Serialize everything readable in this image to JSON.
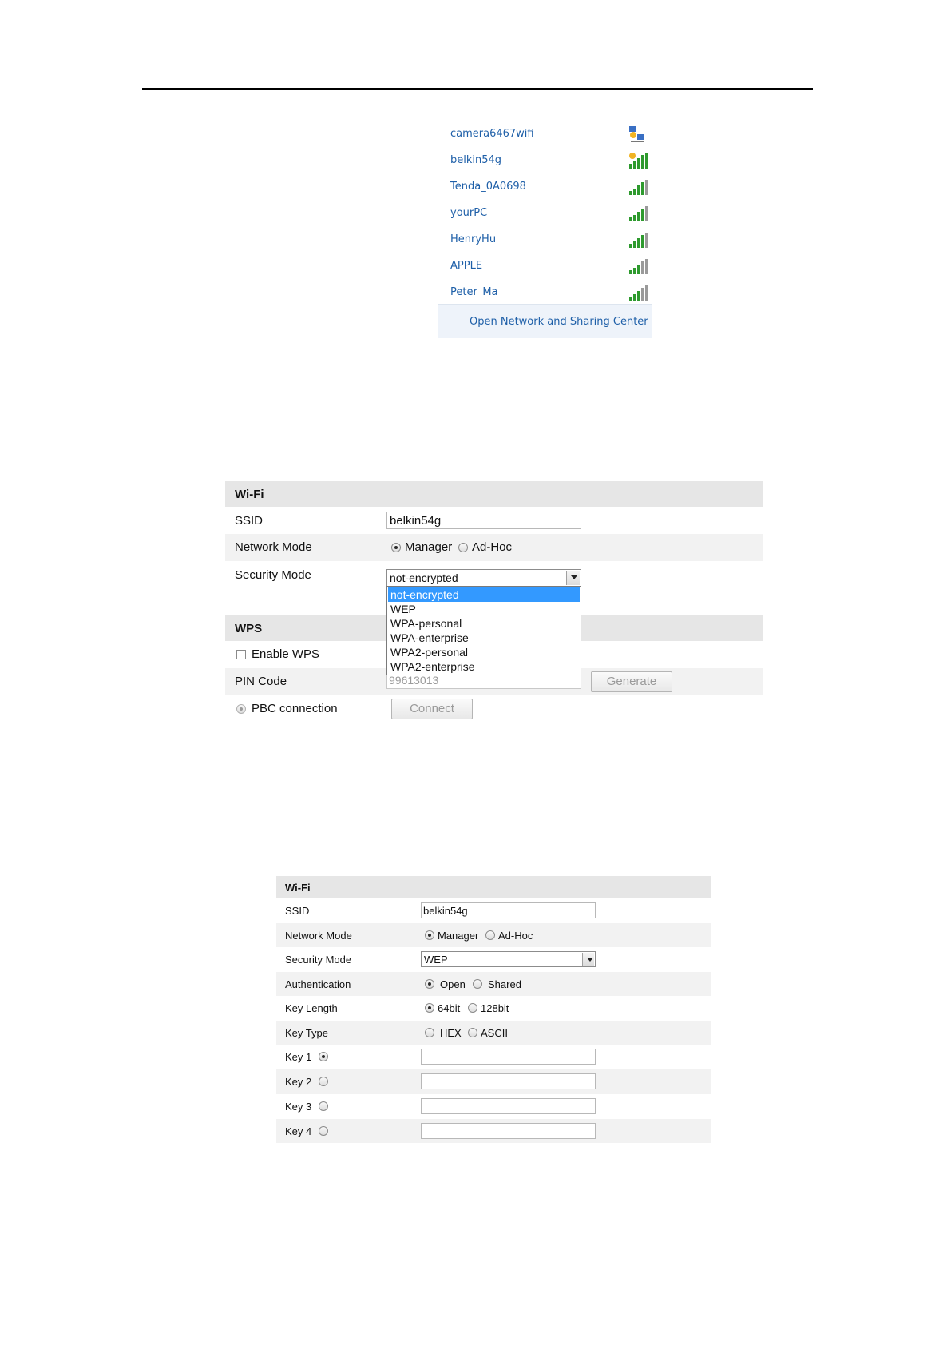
{
  "networks": [
    {
      "name": "camera6467wifi",
      "icon": "adhoc-network-icon"
    },
    {
      "name": "belkin54g",
      "icon": "secured-signal-icon"
    },
    {
      "name": "Tenda_0A0698",
      "icon": "signal-bars-icon"
    },
    {
      "name": "yourPC",
      "icon": "signal-bars-icon"
    },
    {
      "name": "HenryHu",
      "icon": "signal-bars-icon"
    },
    {
      "name": "APPLE",
      "icon": "signal-bars-icon"
    },
    {
      "name": "Peter_Ma",
      "icon": "signal-bars-icon"
    }
  ],
  "network_footer": "Open Network and Sharing Center",
  "form1": {
    "wifi_header": "Wi-Fi",
    "ssid_label": "SSID",
    "ssid_value": "belkin54g",
    "network_mode_label": "Network Mode",
    "manager": "Manager",
    "adhoc": "Ad-Hoc",
    "security_mode_label": "Security Mode",
    "security_value": "not-encrypted",
    "security_options": [
      "not-encrypted",
      "WEP",
      "WPA-personal",
      "WPA-enterprise",
      "WPA2-personal",
      "WPA2-enterprise"
    ],
    "wps_header": "WPS",
    "enable_wps": "Enable WPS",
    "pin_code_label": "PIN Code",
    "pin_code_value": "99613013",
    "generate": "Generate",
    "pbc_connection": "PBC connection",
    "connect": "Connect"
  },
  "form2": {
    "wifi_header": "Wi-Fi",
    "ssid_label": "SSID",
    "ssid_value": "belkin54g",
    "network_mode_label": "Network Mode",
    "manager": "Manager",
    "adhoc": "Ad-Hoc",
    "security_mode_label": "Security Mode",
    "security_value": "WEP",
    "authentication_label": "Authentication",
    "open": "Open",
    "shared": "Shared",
    "key_length_label": "Key Length",
    "bit64": "64bit",
    "bit128": "128bit",
    "key_type_label": "Key Type",
    "hex": "HEX",
    "ascii": "ASCII",
    "key1": "Key 1",
    "key2": "Key 2",
    "key3": "Key 3",
    "key4": "Key 4"
  },
  "colors": {
    "link": "#1e5fa8",
    "selection": "#3399ff",
    "signal_green": "#2e9a2e"
  }
}
